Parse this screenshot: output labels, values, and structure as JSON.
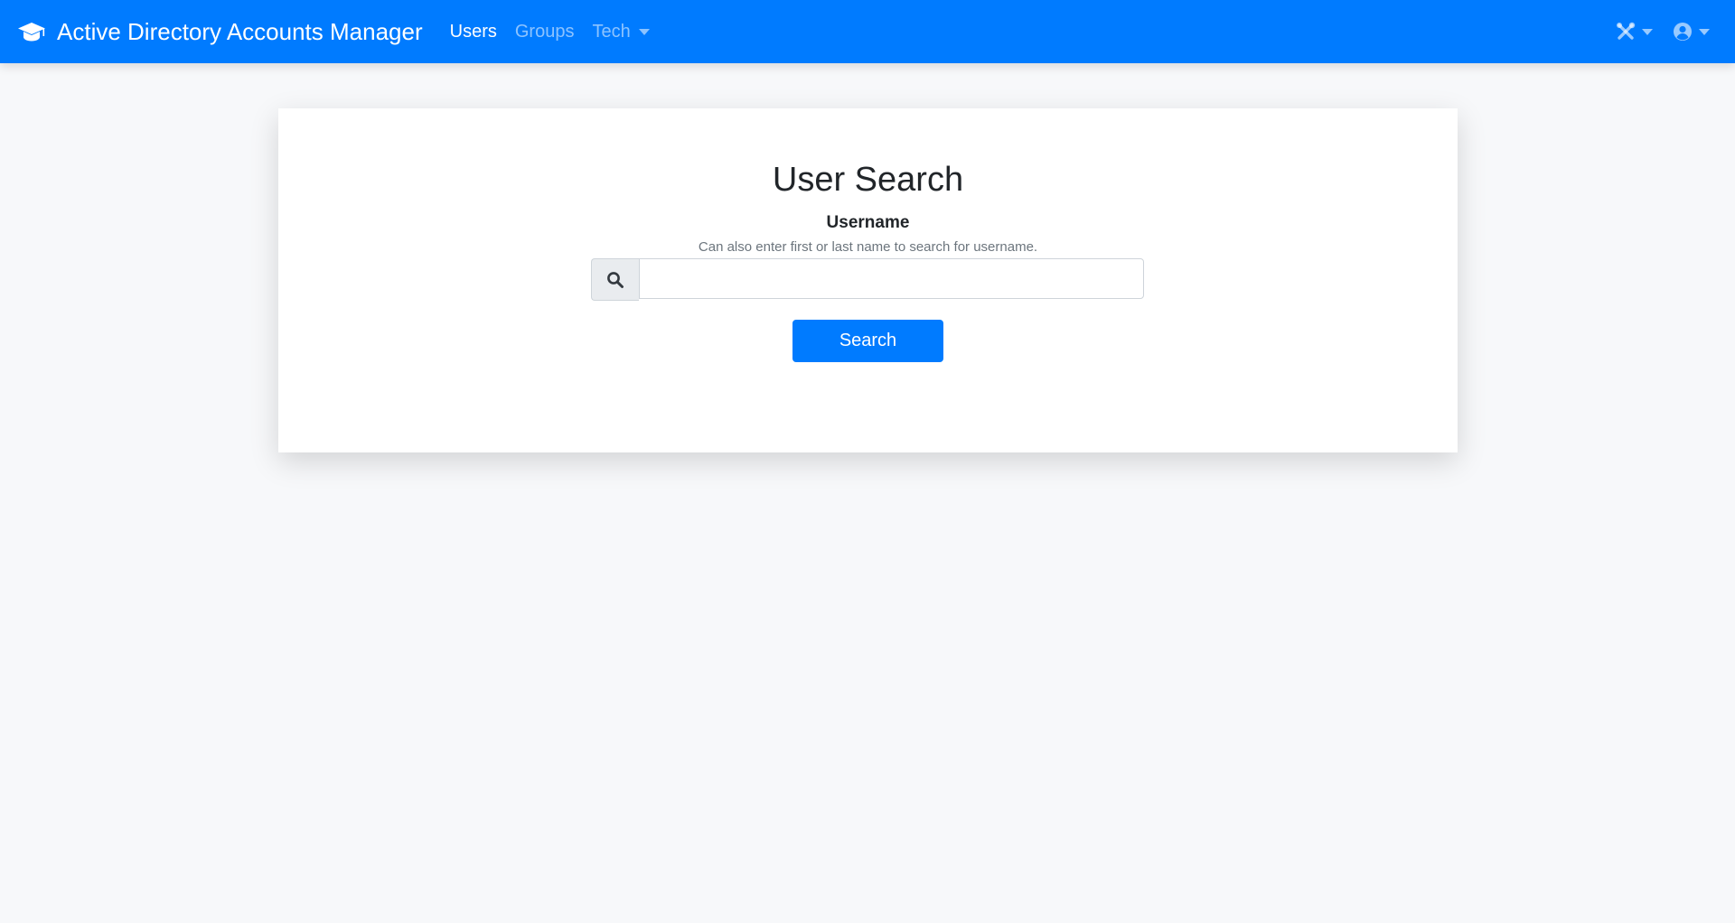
{
  "app": {
    "title": "Active Directory Accounts Manager",
    "brand_icon": "graduation-cap-icon",
    "accent_color": "#007bff"
  },
  "nav": {
    "items": [
      {
        "label": "Users",
        "active": true
      },
      {
        "label": "Groups",
        "active": false
      },
      {
        "label": "Tech",
        "active": false,
        "dropdown": true
      }
    ],
    "right_icons": [
      "tools-icon",
      "user-circle-icon"
    ]
  },
  "search": {
    "title": "User Search",
    "field_label": "Username",
    "help_text": "Can also enter first or last name to search for username.",
    "input_value": "",
    "input_icon": "search-icon",
    "button_label": "Search"
  }
}
